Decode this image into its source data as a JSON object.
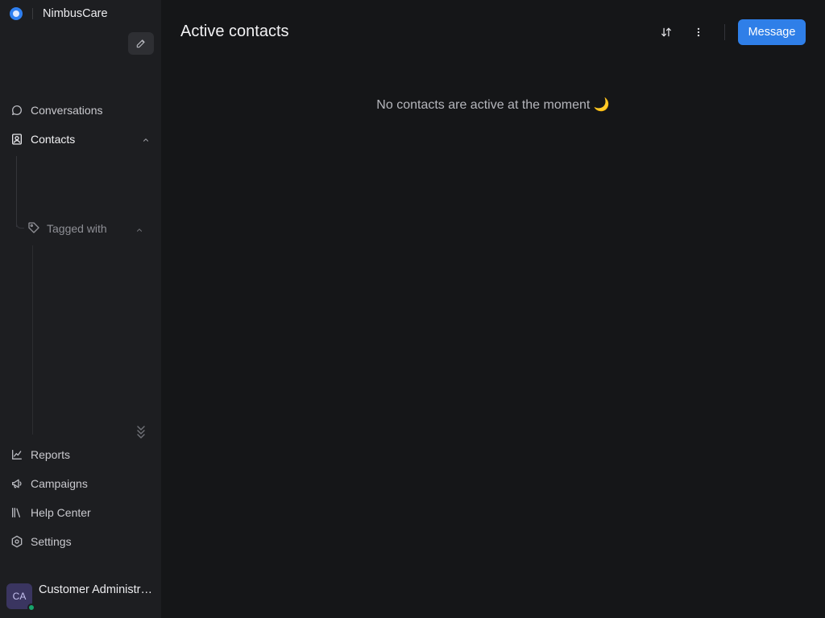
{
  "app": {
    "name": "NimbusCare"
  },
  "sidebar": {
    "items": [
      {
        "label": "Conversations",
        "icon": "chat-bubble-icon"
      },
      {
        "label": "Contacts",
        "icon": "contact-card-icon",
        "expanded": true
      },
      {
        "label": "Reports",
        "icon": "line-chart-icon"
      },
      {
        "label": "Campaigns",
        "icon": "megaphone-icon"
      },
      {
        "label": "Help Center",
        "icon": "library-icon"
      },
      {
        "label": "Settings",
        "icon": "gear-icon"
      }
    ],
    "sub_items": [
      {
        "label": "Tagged with",
        "icon": "tag-icon",
        "expanded": true
      }
    ]
  },
  "user": {
    "initials": "CA",
    "name": "Customer Administrator",
    "status": "online"
  },
  "header": {
    "title": "Active contacts",
    "message_button": "Message"
  },
  "empty_state": {
    "text": "No contacts are active at the moment 🌙"
  },
  "colors": {
    "accent": "#2f7fe8",
    "background": "#151618",
    "sidebar": "#1d1e21",
    "online": "#17a56c"
  }
}
